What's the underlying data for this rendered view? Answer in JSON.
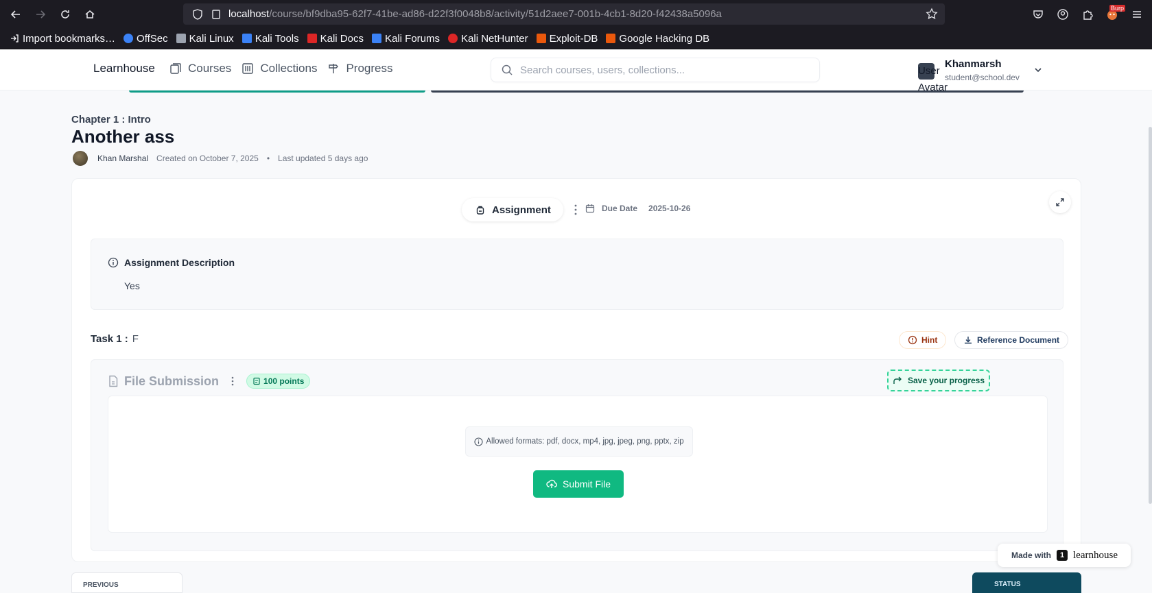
{
  "browser": {
    "url_host": "localhost",
    "url_path": "/course/bf9dba95-62f7-41be-ad86-d22f3f0048b8/activity/51d2aee7-001b-4cb1-8d20-f42438a5096a",
    "bookmarks": [
      {
        "label": "Import bookmarks…",
        "color": "#fbfbfe"
      },
      {
        "label": "OffSec",
        "color": "#3b82f6"
      },
      {
        "label": "Kali Linux",
        "color": "#9ca3af"
      },
      {
        "label": "Kali Tools",
        "color": "#3b82f6"
      },
      {
        "label": "Kali Docs",
        "color": "#dc2626"
      },
      {
        "label": "Kali Forums",
        "color": "#3b82f6"
      },
      {
        "label": "Kali NetHunter",
        "color": "#dc2626"
      },
      {
        "label": "Exploit-DB",
        "color": "#ea580c"
      },
      {
        "label": "Google Hacking DB",
        "color": "#ea580c"
      }
    ],
    "extension_badge": "Burp"
  },
  "header": {
    "brand": "Learnhouse",
    "nav": [
      {
        "label": "Courses",
        "icon": "courses-icon"
      },
      {
        "label": "Collections",
        "icon": "collections-icon"
      },
      {
        "label": "Progress",
        "icon": "progress-icon"
      }
    ],
    "search_placeholder": "Search courses, users, collections...",
    "user": {
      "avatar_alt_line1": "User",
      "avatar_alt_line2": "Avatar",
      "name": "Khanmarsh",
      "email": "student@school.dev"
    }
  },
  "activity": {
    "chapter": "Chapter 1 : Intro",
    "title": "Another ass",
    "author": "Khan Marshal",
    "created": "Created on October 7, 2025",
    "separator": "•",
    "updated": "Last updated 5 days ago",
    "type_label": "Assignment",
    "due_label": "Due Date",
    "due_value": "2025-10-26"
  },
  "description": {
    "heading": "Assignment Description",
    "body": "Yes"
  },
  "task": {
    "title": "Task 1 :",
    "value": "F",
    "hint_label": "Hint",
    "reference_label": "Reference Document",
    "submission_title": "File Submission",
    "points": "100 points",
    "save_label": "Save your progress",
    "formats": "Allowed formats: pdf, docx, mp4, jpg, jpeg, png, pptx, zip",
    "submit_label": "Submit File"
  },
  "footer": {
    "made_with": "Made with",
    "made_with_brand": "learnhouse",
    "brand_initial": "1",
    "previous_label": "PREVIOUS",
    "status_label": "STATUS"
  },
  "colors": {
    "accent_green": "#10b981",
    "progress_green": "#0f9d88",
    "status_teal": "#0e4a5e"
  }
}
